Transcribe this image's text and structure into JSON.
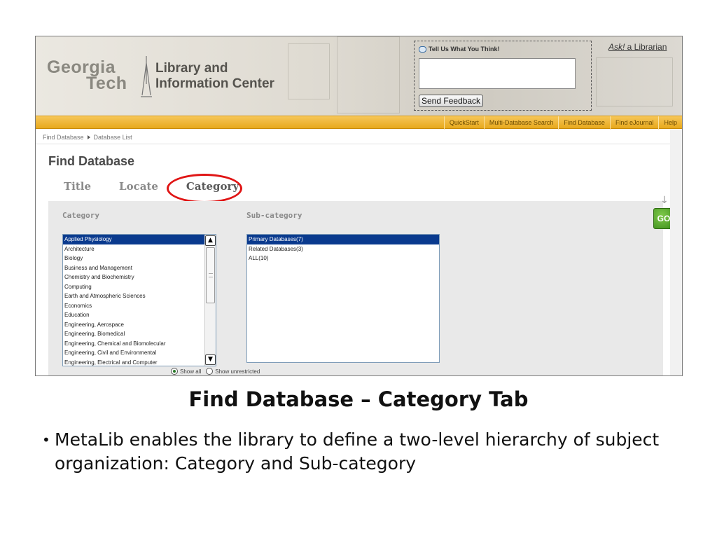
{
  "logo": {
    "georgia": "Georgia",
    "tech": "Tech",
    "line1": "Library and",
    "line2": "Information Center"
  },
  "feedback": {
    "title": "Tell Us What You Think!",
    "button": "Send Feedback",
    "input_value": ""
  },
  "ask": {
    "prefix": "Ask!",
    "suffix": " a Librarian"
  },
  "nav": {
    "items": [
      "QuickStart",
      "Multi-Database Search",
      "Find Database",
      "Find eJournal",
      "Help"
    ]
  },
  "breadcrumb": {
    "item1": "Find Database",
    "item2": "Database List"
  },
  "page": {
    "title": "Find Database",
    "tabs": [
      "Title",
      "Locate",
      "Category"
    ],
    "active_tab": "Category"
  },
  "category": {
    "label": "Category",
    "items": [
      "Applied Physiology",
      "Architecture",
      "Biology",
      "Business and Management",
      "Chemistry and Biochemistry",
      "Computing",
      "Earth and Atmospheric Sciences",
      "Economics",
      "Education",
      "Engineering, Aerospace",
      "Engineering, Biomedical",
      "Engineering, Chemical and Biomolecular",
      "Engineering, Civil and Environmental",
      "Engineering, Electrical and Computer"
    ],
    "selected": "Applied Physiology"
  },
  "subcategory": {
    "label": "Sub-category",
    "items": [
      "Primary Databases(7)",
      "Related Databases(3)",
      "ALL(10)"
    ],
    "selected": "Primary Databases(7)"
  },
  "filter": {
    "show_all": "Show all",
    "show_unrestricted": "Show unrestricted",
    "selected": "Show all"
  },
  "go": {
    "label": "GO",
    "arrow": "↓"
  },
  "slide": {
    "title": "Find Database – Category Tab",
    "bullet": "MetaLib enables the library to define a two-level hierarchy of subject organization: Category and Sub-category"
  },
  "colors": {
    "nav_bar": "#e8a91c",
    "highlight_circle": "#e01515",
    "selected_item": "#0a3a8e",
    "go_button": "#3d8f1c"
  }
}
